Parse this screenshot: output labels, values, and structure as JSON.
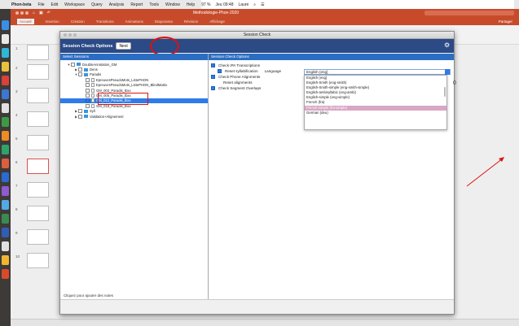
{
  "menubar": {
    "app": "Phon-beta",
    "items": [
      "File",
      "Edit",
      "Workspace",
      "Query",
      "Analysis",
      "Report",
      "Tools",
      "Window",
      "Help"
    ],
    "battery": "97 %",
    "clock": "Jeu 09:48",
    "user": "Laure"
  },
  "ppt": {
    "doc_title": "Methodologie-Phon-2020",
    "tabs": [
      "Accueil",
      "Insertion",
      "Création",
      "Transitions",
      "Animations",
      "Diaporama",
      "Révision",
      "Affichage"
    ],
    "share": "Partager",
    "slide_numbers": [
      "1",
      "2",
      "3",
      "4",
      "5",
      "6",
      "7",
      "8",
      "9",
      "10"
    ]
  },
  "dialog": {
    "window_title": "Session Check",
    "header_title": "Session Check Options",
    "next_button": "Next",
    "left_header": "Select Sessions",
    "right_header": "Session Check Options",
    "footer_hint": "Cliquez pour ajouter des notes",
    "tree": [
      {
        "label": "DoubleAnnotation_GM",
        "level": 0,
        "arrow": "▼",
        "check": "off",
        "type": "folder"
      },
      {
        "label": "Dens",
        "level": 1,
        "arrow": "▶",
        "check": "off",
        "type": "folder"
      },
      {
        "label": "Paradis",
        "level": 1,
        "arrow": "▼",
        "check": "off",
        "type": "folder"
      },
      {
        "label": "EpreuvesPseudoMots_ListePHON",
        "level": 2,
        "arrow": "",
        "check": "off",
        "type": "file"
      },
      {
        "label": "EpreuvesPseudoMots_ListePHON_BlindMatrix",
        "level": 2,
        "arrow": "",
        "check": "off",
        "type": "file"
      },
      {
        "label": "GM_003_Paradis_tbxx",
        "level": 2,
        "arrow": "",
        "check": "off",
        "type": "file"
      },
      {
        "label": "GM_005_Paradis_tbxx",
        "level": 2,
        "arrow": "",
        "check": "off",
        "type": "file"
      },
      {
        "label": "GM_012_Paradis_tbxx",
        "level": 2,
        "arrow": "",
        "check": "on",
        "type": "file",
        "selected": true
      },
      {
        "label": "GM_018_Paradis_tbxx",
        "level": 2,
        "arrow": "",
        "check": "off",
        "type": "file"
      },
      {
        "label": "Syll",
        "level": 1,
        "arrow": "▶",
        "check": "off",
        "type": "folder"
      },
      {
        "label": "Validation+Alignement",
        "level": 1,
        "arrow": "▶",
        "check": "off",
        "type": "folder"
      }
    ],
    "options": {
      "check_ipa": "Check IPA Transcriptions",
      "reset_syll": "Reset syllabification",
      "language_label": "Language",
      "language_value": "English (eng)",
      "check_phone": "Check Phone Alignments",
      "reset_align": "Reset alignments",
      "check_segment": "Check Segment Overlaps"
    },
    "languages": [
      "English (eng)",
      "English-Smith (eng-smith)",
      "English-Smith-simple (eng-smith-simple)",
      "English-ambisyllabic (eng-ambi)",
      "English-simple (eng-simple)",
      "French (fra)",
      "French-simple (fra-simple)",
      "German (deu)"
    ],
    "highlighted_language": "French-simple (fra-simple)",
    "peek_glyph": "0"
  }
}
